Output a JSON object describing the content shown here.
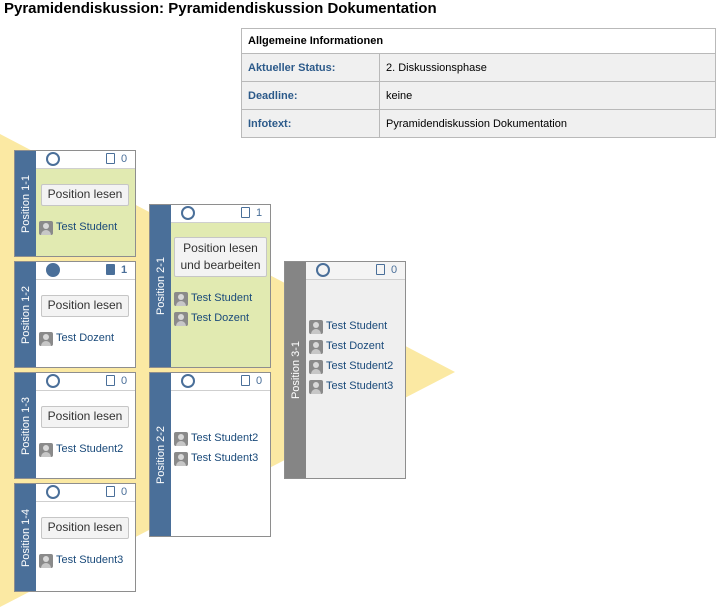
{
  "title": "Pyramidendiskussion: Pyramidendiskussion Dokumentation",
  "info": {
    "header": "Allgemeine Informationen",
    "rows": [
      {
        "label": "Aktueller Status:",
        "value": "2. Diskussionsphase"
      },
      {
        "label": "Deadline:",
        "value": "keine"
      },
      {
        "label": "Infotext:",
        "value": "Pyramidendiskussion Dokumentation"
      }
    ]
  },
  "positions": {
    "p11": {
      "label": "Position 1-1",
      "count": "0",
      "button": "Position lesen",
      "members": [
        "Test Student"
      ]
    },
    "p12": {
      "label": "Position 1-2",
      "count": "1",
      "button": "Position lesen",
      "members": [
        "Test Dozent"
      ]
    },
    "p13": {
      "label": "Position 1-3",
      "count": "0",
      "button": "Position lesen",
      "members": [
        "Test Student2"
      ]
    },
    "p14": {
      "label": "Position 1-4",
      "count": "0",
      "button": "Position lesen",
      "members": [
        "Test Student3"
      ]
    },
    "p21": {
      "label": "Position 2-1",
      "count": "1",
      "button_line1": "Position lesen",
      "button_line2": "und bearbeiten",
      "members": [
        "Test Student",
        "Test Dozent"
      ]
    },
    "p22": {
      "label": "Position 2-2",
      "count": "0",
      "members": [
        "Test Student2",
        "Test Student3"
      ]
    },
    "p31": {
      "label": "Position 3-1",
      "count": "0",
      "members": [
        "Test Student",
        "Test Dozent",
        "Test Student2",
        "Test Student3"
      ]
    }
  },
  "colors": {
    "accent": "#4a6f99",
    "active_bg": "#e1eab1",
    "pyramid": "#fbe9a3",
    "final_bar": "#858585"
  }
}
